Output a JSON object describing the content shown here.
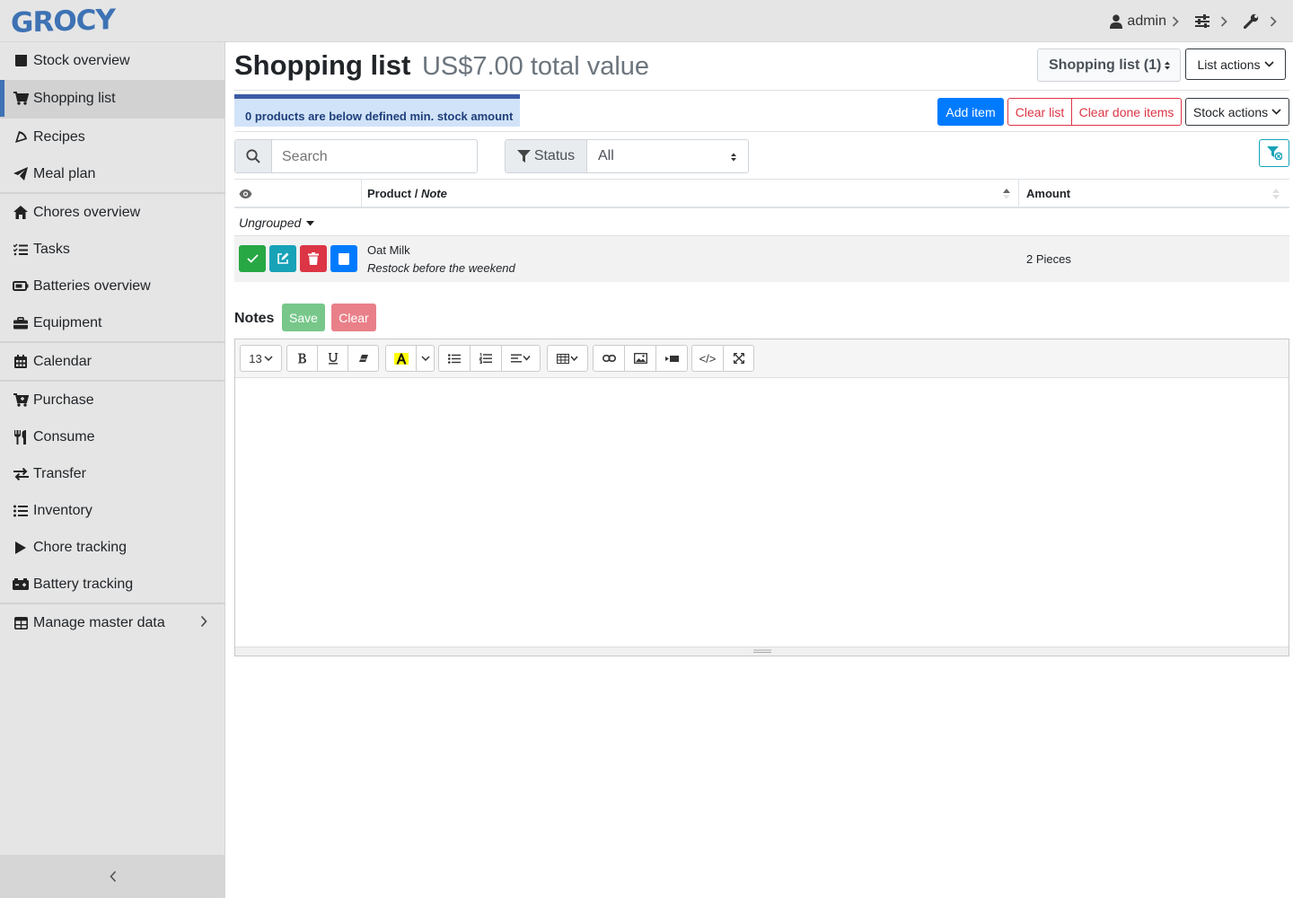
{
  "app": {
    "logo_text": "GROCY",
    "accent": "#3e72b4"
  },
  "topnav": {
    "user": "admin"
  },
  "sidebar": {
    "items": [
      {
        "label": "Stock overview",
        "icon": "box-icon"
      },
      {
        "label": "Shopping list",
        "icon": "cart-icon",
        "active": true
      },
      {
        "label": "Recipes",
        "icon": "pizza-icon"
      },
      {
        "label": "Meal plan",
        "icon": "paper-plane-icon"
      },
      {
        "label": "Chores overview",
        "icon": "home-icon"
      },
      {
        "label": "Tasks",
        "icon": "tasks-icon"
      },
      {
        "label": "Batteries overview",
        "icon": "battery-icon"
      },
      {
        "label": "Equipment",
        "icon": "toolbox-icon"
      },
      {
        "label": "Calendar",
        "icon": "calendar-icon"
      },
      {
        "label": "Purchase",
        "icon": "cart-plus-icon"
      },
      {
        "label": "Consume",
        "icon": "utensils-icon"
      },
      {
        "label": "Transfer",
        "icon": "exchange-icon"
      },
      {
        "label": "Inventory",
        "icon": "list-icon"
      },
      {
        "label": "Chore tracking",
        "icon": "play-icon"
      },
      {
        "label": "Battery tracking",
        "icon": "car-battery-icon"
      },
      {
        "label": "Manage master data",
        "icon": "table-icon"
      }
    ]
  },
  "page": {
    "title": "Shopping list",
    "subtitle": "US$7.00 total value",
    "shopping_list_select": "Shopping list (1)",
    "list_actions": "List actions",
    "alert": "0 products are below defined min. stock amount",
    "add_item": "Add item",
    "clear_list": "Clear list",
    "clear_done": "Clear done items",
    "stock_actions": "Stock actions",
    "search_placeholder": "Search",
    "status_label": "Status",
    "status_value": "All"
  },
  "table": {
    "columns": {
      "product": "Product / ",
      "note": "Note",
      "amount": "Amount"
    },
    "group": "Ungrouped",
    "rows": [
      {
        "product": "Oat Milk",
        "note": "Restock before the weekend",
        "amount": "2 Pieces"
      }
    ]
  },
  "notes": {
    "label": "Notes",
    "save": "Save",
    "clear": "Clear",
    "font_size": "13",
    "code_label": "</>"
  }
}
